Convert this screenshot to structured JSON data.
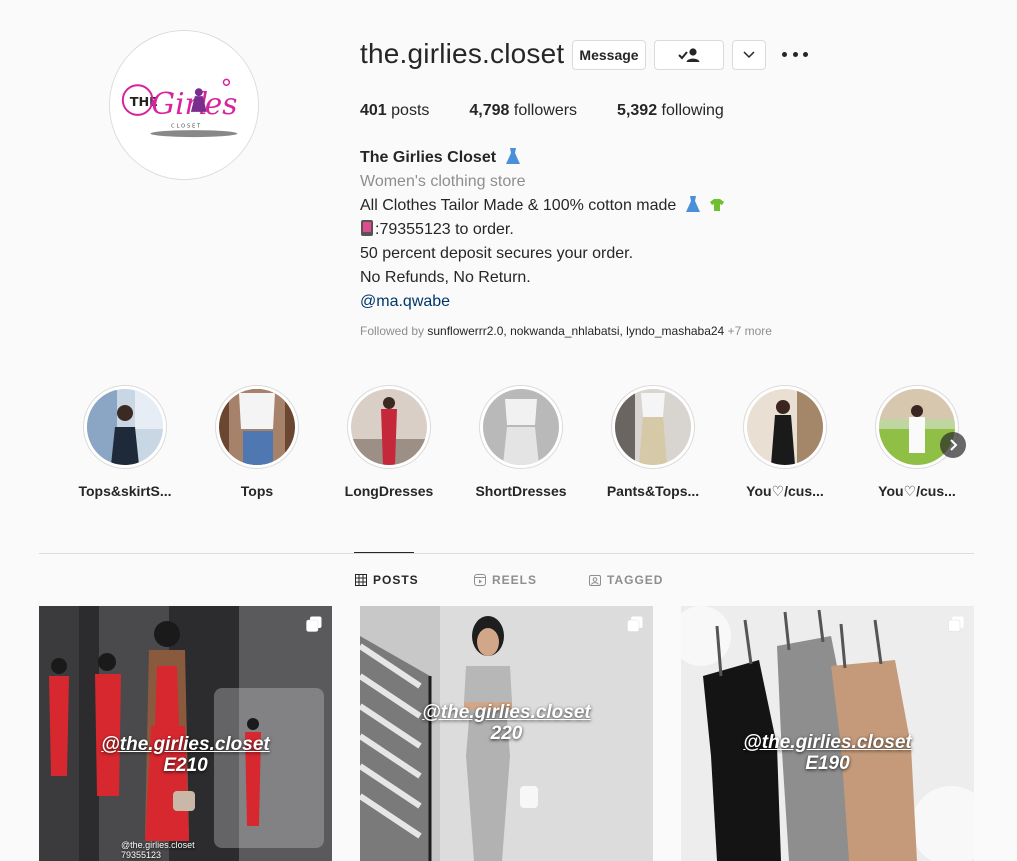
{
  "profile": {
    "username": "the.girlies.closet",
    "logo_text": "THE Girlies",
    "logo_subtext": "CLOSET",
    "buttons": {
      "message": "Message",
      "follow_icon": "person-check-icon",
      "dropdown_icon": "chevron-down-icon",
      "more_icon": "more-horizontal-icon"
    },
    "stats": {
      "posts": "401",
      "posts_label": "posts",
      "followers": "4,798",
      "followers_label": "followers",
      "following": "5,392",
      "following_label": "following"
    }
  },
  "bio": {
    "name": "The Girlies Closet",
    "category": "Women's clothing store",
    "line1": "All Clothes Tailor Made & 100% cotton made",
    "line2": ":79355123 to order.",
    "line3": "50 percent deposit secures your order.",
    "line4": "No Refunds, No Return.",
    "link": "@ma.qwabe",
    "followed_prefix": "Followed by",
    "followed_names": "sunflowerrr2.0, nokwanda_nhlabatsi, lyndo_mashaba24",
    "followed_more": "+7 more"
  },
  "highlights": [
    {
      "label": "Tops&skirtS..."
    },
    {
      "label": "Tops"
    },
    {
      "label": "LongDresses"
    },
    {
      "label": "ShortDresses"
    },
    {
      "label": "Pants&Tops..."
    },
    {
      "label": "You♡/cus..."
    },
    {
      "label": "You♡/cus..."
    }
  ],
  "tabs": {
    "posts": "POSTS",
    "reels": "REELS",
    "tagged": "TAGGED"
  },
  "posts": [
    {
      "handle": "@the.girlies.closet",
      "price": "E210",
      "watermark": "@the.girlies.closet",
      "watermark2": "79355123"
    },
    {
      "handle": "@the.girlies.closet",
      "price": "220"
    },
    {
      "handle": "@the.girlies.closet",
      "price": "E190"
    }
  ],
  "colors": {
    "accent_link": "#00376b",
    "logo_pink": "#d6249f",
    "logo_purple": "#7b2d8e"
  }
}
